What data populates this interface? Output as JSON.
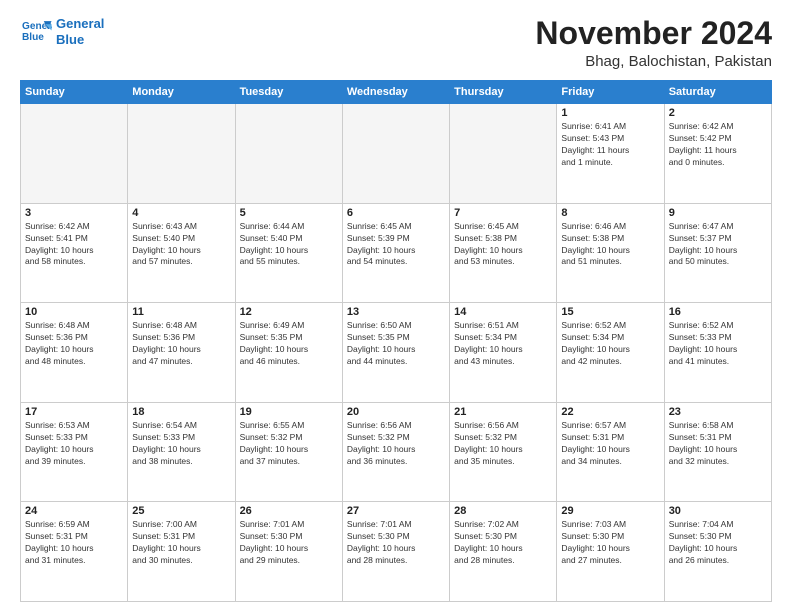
{
  "logo": {
    "line1": "General",
    "line2": "Blue"
  },
  "title": "November 2024",
  "location": "Bhag, Balochistan, Pakistan",
  "weekdays": [
    "Sunday",
    "Monday",
    "Tuesday",
    "Wednesday",
    "Thursday",
    "Friday",
    "Saturday"
  ],
  "weeks": [
    [
      {
        "day": "",
        "info": ""
      },
      {
        "day": "",
        "info": ""
      },
      {
        "day": "",
        "info": ""
      },
      {
        "day": "",
        "info": ""
      },
      {
        "day": "",
        "info": ""
      },
      {
        "day": "1",
        "info": "Sunrise: 6:41 AM\nSunset: 5:43 PM\nDaylight: 11 hours\nand 1 minute."
      },
      {
        "day": "2",
        "info": "Sunrise: 6:42 AM\nSunset: 5:42 PM\nDaylight: 11 hours\nand 0 minutes."
      }
    ],
    [
      {
        "day": "3",
        "info": "Sunrise: 6:42 AM\nSunset: 5:41 PM\nDaylight: 10 hours\nand 58 minutes."
      },
      {
        "day": "4",
        "info": "Sunrise: 6:43 AM\nSunset: 5:40 PM\nDaylight: 10 hours\nand 57 minutes."
      },
      {
        "day": "5",
        "info": "Sunrise: 6:44 AM\nSunset: 5:40 PM\nDaylight: 10 hours\nand 55 minutes."
      },
      {
        "day": "6",
        "info": "Sunrise: 6:45 AM\nSunset: 5:39 PM\nDaylight: 10 hours\nand 54 minutes."
      },
      {
        "day": "7",
        "info": "Sunrise: 6:45 AM\nSunset: 5:38 PM\nDaylight: 10 hours\nand 53 minutes."
      },
      {
        "day": "8",
        "info": "Sunrise: 6:46 AM\nSunset: 5:38 PM\nDaylight: 10 hours\nand 51 minutes."
      },
      {
        "day": "9",
        "info": "Sunrise: 6:47 AM\nSunset: 5:37 PM\nDaylight: 10 hours\nand 50 minutes."
      }
    ],
    [
      {
        "day": "10",
        "info": "Sunrise: 6:48 AM\nSunset: 5:36 PM\nDaylight: 10 hours\nand 48 minutes."
      },
      {
        "day": "11",
        "info": "Sunrise: 6:48 AM\nSunset: 5:36 PM\nDaylight: 10 hours\nand 47 minutes."
      },
      {
        "day": "12",
        "info": "Sunrise: 6:49 AM\nSunset: 5:35 PM\nDaylight: 10 hours\nand 46 minutes."
      },
      {
        "day": "13",
        "info": "Sunrise: 6:50 AM\nSunset: 5:35 PM\nDaylight: 10 hours\nand 44 minutes."
      },
      {
        "day": "14",
        "info": "Sunrise: 6:51 AM\nSunset: 5:34 PM\nDaylight: 10 hours\nand 43 minutes."
      },
      {
        "day": "15",
        "info": "Sunrise: 6:52 AM\nSunset: 5:34 PM\nDaylight: 10 hours\nand 42 minutes."
      },
      {
        "day": "16",
        "info": "Sunrise: 6:52 AM\nSunset: 5:33 PM\nDaylight: 10 hours\nand 41 minutes."
      }
    ],
    [
      {
        "day": "17",
        "info": "Sunrise: 6:53 AM\nSunset: 5:33 PM\nDaylight: 10 hours\nand 39 minutes."
      },
      {
        "day": "18",
        "info": "Sunrise: 6:54 AM\nSunset: 5:33 PM\nDaylight: 10 hours\nand 38 minutes."
      },
      {
        "day": "19",
        "info": "Sunrise: 6:55 AM\nSunset: 5:32 PM\nDaylight: 10 hours\nand 37 minutes."
      },
      {
        "day": "20",
        "info": "Sunrise: 6:56 AM\nSunset: 5:32 PM\nDaylight: 10 hours\nand 36 minutes."
      },
      {
        "day": "21",
        "info": "Sunrise: 6:56 AM\nSunset: 5:32 PM\nDaylight: 10 hours\nand 35 minutes."
      },
      {
        "day": "22",
        "info": "Sunrise: 6:57 AM\nSunset: 5:31 PM\nDaylight: 10 hours\nand 34 minutes."
      },
      {
        "day": "23",
        "info": "Sunrise: 6:58 AM\nSunset: 5:31 PM\nDaylight: 10 hours\nand 32 minutes."
      }
    ],
    [
      {
        "day": "24",
        "info": "Sunrise: 6:59 AM\nSunset: 5:31 PM\nDaylight: 10 hours\nand 31 minutes."
      },
      {
        "day": "25",
        "info": "Sunrise: 7:00 AM\nSunset: 5:31 PM\nDaylight: 10 hours\nand 30 minutes."
      },
      {
        "day": "26",
        "info": "Sunrise: 7:01 AM\nSunset: 5:30 PM\nDaylight: 10 hours\nand 29 minutes."
      },
      {
        "day": "27",
        "info": "Sunrise: 7:01 AM\nSunset: 5:30 PM\nDaylight: 10 hours\nand 28 minutes."
      },
      {
        "day": "28",
        "info": "Sunrise: 7:02 AM\nSunset: 5:30 PM\nDaylight: 10 hours\nand 28 minutes."
      },
      {
        "day": "29",
        "info": "Sunrise: 7:03 AM\nSunset: 5:30 PM\nDaylight: 10 hours\nand 27 minutes."
      },
      {
        "day": "30",
        "info": "Sunrise: 7:04 AM\nSunset: 5:30 PM\nDaylight: 10 hours\nand 26 minutes."
      }
    ]
  ]
}
